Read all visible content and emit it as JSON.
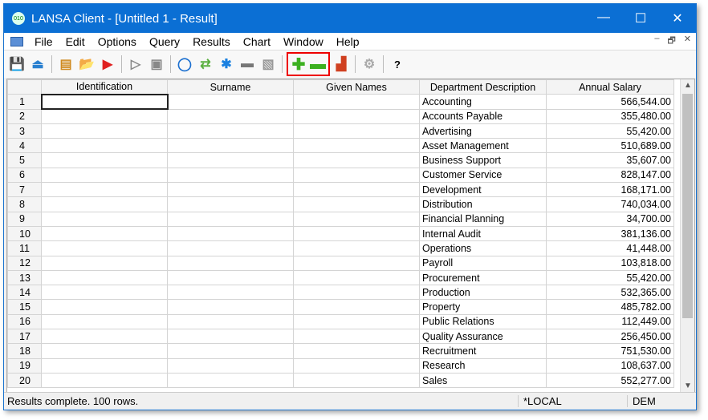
{
  "title": "LANSA Client - [Untitled 1 - Result]",
  "logo_text": "010",
  "window_controls": {
    "minimize": "—",
    "maximize": "☐",
    "close": "✕"
  },
  "menu": [
    "File",
    "Edit",
    "Options",
    "Query",
    "Results",
    "Chart",
    "Window",
    "Help"
  ],
  "mdi_controls": [
    "–",
    "🗗",
    "✕"
  ],
  "toolbar": {
    "help": "?"
  },
  "columns": [
    "Identification",
    "Surname",
    "Given Names",
    "Department Description",
    "Annual Salary"
  ],
  "rows": [
    [
      "1",
      "Accounting",
      "566,544.00"
    ],
    [
      "2",
      "Accounts Payable",
      "355,480.00"
    ],
    [
      "3",
      "Advertising",
      "55,420.00"
    ],
    [
      "4",
      "Asset Management",
      "510,689.00"
    ],
    [
      "5",
      "Business Support",
      "35,607.00"
    ],
    [
      "6",
      "Customer Service",
      "828,147.00"
    ],
    [
      "7",
      "Development",
      "168,171.00"
    ],
    [
      "8",
      "Distribution",
      "740,034.00"
    ],
    [
      "9",
      "Financial Planning",
      "34,700.00"
    ],
    [
      "10",
      "Internal Audit",
      "381,136.00"
    ],
    [
      "11",
      "Operations",
      "41,448.00"
    ],
    [
      "12",
      "Payroll",
      "103,818.00"
    ],
    [
      "13",
      "Procurement",
      "55,420.00"
    ],
    [
      "14",
      "Production",
      "532,365.00"
    ],
    [
      "15",
      "Property",
      "485,782.00"
    ],
    [
      "16",
      "Public Relations",
      "112,449.00"
    ],
    [
      "17",
      "Quality Assurance",
      "256,450.00"
    ],
    [
      "18",
      "Recruitment",
      "751,530.00"
    ],
    [
      "19",
      "Research",
      "108,637.00"
    ],
    [
      "20",
      "Sales",
      "552,277.00"
    ]
  ],
  "status": {
    "message": "Results complete. 100 rows.",
    "location": "*LOCAL",
    "partition": "DEM"
  }
}
